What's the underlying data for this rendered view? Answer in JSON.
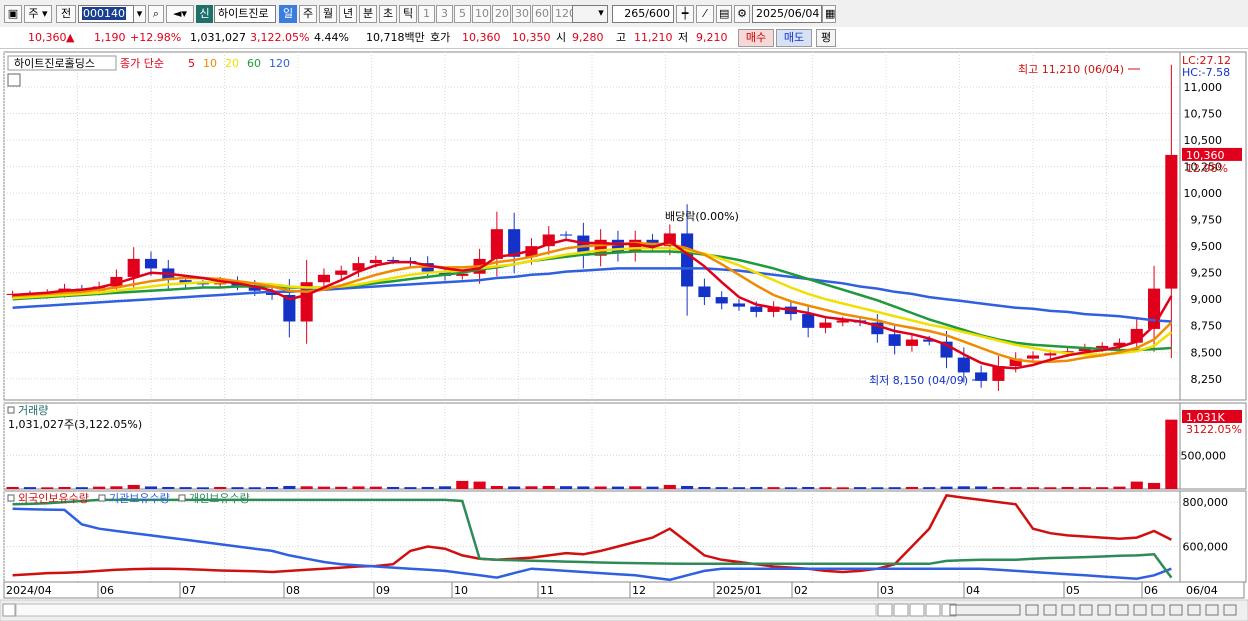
{
  "toolbar": {
    "period_type": "주",
    "prev_label": "전",
    "stock_code": "000140",
    "credit_badge": "신",
    "stock_name": "하이트진로",
    "period_buttons": [
      "일",
      "주",
      "월",
      "년",
      "분",
      "초",
      "틱"
    ],
    "interval_buttons": [
      "1",
      "3",
      "5",
      "10",
      "20",
      "30",
      "60",
      "120"
    ],
    "count_value": "265",
    "count_max": "/600",
    "date": "2025/06/04"
  },
  "quote": {
    "price": "10,360",
    "change_arrow": "▲",
    "change": "1,190",
    "change_pct": "+12.98%",
    "volume": "1,031,027",
    "volume_ratio": "3,122.05%",
    "turnover": "4.44%",
    "amount": "10,718백만",
    "bid_label": "호가",
    "ask_price": "10,360",
    "bid_price": "10,350",
    "open_label": "시",
    "open": "9,280",
    "high_label": "고",
    "high": "11,210",
    "low_label": "저",
    "low": "9,210",
    "buy_label": "매수",
    "sell_label": "매도",
    "eval_label": "평"
  },
  "colors": {
    "up": "#e0001b",
    "down": "#1432c8",
    "ma5": "#e0001b",
    "ma10": "#f08a00",
    "ma20": "#f0e000",
    "ma60": "#1e9a3c",
    "ma120": "#3060e0",
    "foreign": "#d01010",
    "institution": "#3060e0",
    "individual": "#2e8b57"
  },
  "chart_data": [
    {
      "type": "candlestick",
      "title": "하이트진로홀딩스",
      "legend_prefix": "종가 단순",
      "ma_periods": [
        "5",
        "10",
        "20",
        "60",
        "120"
      ],
      "y_ticks": [
        11000,
        10750,
        10500,
        10250,
        10000,
        9750,
        9500,
        9250,
        9000,
        8750,
        8500,
        8250
      ],
      "y_tick_labels": [
        "11,000",
        "10,750",
        "10,500",
        "10,250",
        "10,000",
        "9,750",
        "9,500",
        "9,250",
        "9,000",
        "8,750",
        "8,500",
        "8,250"
      ],
      "ylim": [
        8050,
        11330
      ],
      "lc_label": "LC:27.12",
      "hc_label": "HC:-7.58",
      "last_price_label": "10,360",
      "last_pct_label": "12.98%",
      "high_annotation": "최고 11,210 (06/04)",
      "low_annotation": "최저 8,150 (04/09)",
      "dividend_annotation": "배당락(0.00%)",
      "close": [
        9050,
        9040,
        9060,
        9100,
        9080,
        9120,
        9210,
        9380,
        9290,
        9180,
        9150,
        9140,
        9170,
        9130,
        9080,
        9040,
        8790,
        9160,
        9230,
        9270,
        9340,
        9370,
        9360,
        9340,
        9260,
        9220,
        9240,
        9380,
        9660,
        9400,
        9500,
        9610,
        9600,
        9410,
        9560,
        9440,
        9560,
        9500,
        9620,
        9120,
        9020,
        8960,
        8930,
        8880,
        8930,
        8860,
        8730,
        8780,
        8800,
        8780,
        8670,
        8560,
        8620,
        8600,
        8450,
        8310,
        8230,
        8370,
        8440,
        8470,
        8490,
        8510,
        8540,
        8560,
        8590,
        8720,
        9100,
        10360
      ],
      "ma5": [
        9040,
        9050,
        9060,
        9080,
        9090,
        9110,
        9150,
        9200,
        9250,
        9240,
        9220,
        9200,
        9170,
        9150,
        9120,
        9080,
        9000,
        9040,
        9110,
        9180,
        9260,
        9320,
        9350,
        9350,
        9320,
        9290,
        9270,
        9290,
        9400,
        9420,
        9460,
        9520,
        9560,
        9530,
        9530,
        9520,
        9520,
        9490,
        9540,
        9430,
        9310,
        9160,
        9020,
        8950,
        8920,
        8900,
        8870,
        8830,
        8810,
        8790,
        8750,
        8700,
        8670,
        8630,
        8570,
        8480,
        8400,
        8360,
        8350,
        8380,
        8430,
        8470,
        8500,
        8520,
        8550,
        8600,
        8750,
        9030
      ],
      "ma10": [
        9030,
        9040,
        9050,
        9060,
        9070,
        9090,
        9110,
        9140,
        9170,
        9190,
        9200,
        9200,
        9190,
        9170,
        9150,
        9120,
        9080,
        9070,
        9090,
        9130,
        9180,
        9230,
        9270,
        9300,
        9310,
        9300,
        9300,
        9310,
        9350,
        9370,
        9400,
        9440,
        9480,
        9500,
        9510,
        9520,
        9530,
        9520,
        9520,
        9480,
        9420,
        9330,
        9230,
        9130,
        9040,
        8980,
        8940,
        8900,
        8860,
        8830,
        8800,
        8760,
        8730,
        8700,
        8660,
        8600,
        8540,
        8480,
        8430,
        8410,
        8410,
        8420,
        8450,
        8470,
        8500,
        8540,
        8620,
        8780
      ],
      "ma20": [
        9010,
        9020,
        9030,
        9040,
        9050,
        9060,
        9080,
        9100,
        9120,
        9140,
        9150,
        9160,
        9160,
        9160,
        9150,
        9140,
        9120,
        9110,
        9110,
        9120,
        9140,
        9170,
        9200,
        9230,
        9250,
        9260,
        9270,
        9290,
        9310,
        9330,
        9360,
        9390,
        9420,
        9440,
        9460,
        9470,
        9480,
        9480,
        9480,
        9460,
        9430,
        9380,
        9320,
        9250,
        9180,
        9110,
        9050,
        9000,
        8960,
        8920,
        8880,
        8840,
        8800,
        8760,
        8730,
        8690,
        8650,
        8610,
        8570,
        8540,
        8510,
        8490,
        8480,
        8480,
        8490,
        8510,
        8560,
        8690
      ],
      "ma60": [
        9000,
        9010,
        9020,
        9030,
        9040,
        9050,
        9060,
        9070,
        9080,
        9090,
        9100,
        9110,
        9110,
        9120,
        9120,
        9120,
        9110,
        9110,
        9110,
        9120,
        9130,
        9150,
        9170,
        9190,
        9210,
        9230,
        9250,
        9280,
        9300,
        9330,
        9360,
        9380,
        9400,
        9420,
        9430,
        9440,
        9450,
        9450,
        9450,
        9440,
        9420,
        9400,
        9370,
        9330,
        9290,
        9240,
        9190,
        9140,
        9090,
        9040,
        8990,
        8930,
        8870,
        8810,
        8760,
        8710,
        8660,
        8620,
        8590,
        8570,
        8560,
        8550,
        8540,
        8530,
        8520,
        8520,
        8530,
        8540
      ],
      "ma120": [
        8920,
        8930,
        8940,
        8950,
        8960,
        8970,
        8980,
        8990,
        9000,
        9010,
        9020,
        9030,
        9040,
        9050,
        9060,
        9070,
        9070,
        9080,
        9090,
        9100,
        9110,
        9120,
        9130,
        9140,
        9150,
        9160,
        9170,
        9180,
        9200,
        9210,
        9230,
        9240,
        9260,
        9270,
        9280,
        9290,
        9290,
        9290,
        9290,
        9290,
        9290,
        9280,
        9270,
        9250,
        9230,
        9210,
        9190,
        9170,
        9150,
        9120,
        9100,
        9070,
        9050,
        9020,
        9000,
        8980,
        8960,
        8940,
        8920,
        8910,
        8890,
        8880,
        8860,
        8850,
        8840,
        8820,
        8800,
        8790
      ]
    },
    {
      "type": "bar",
      "title": "거래량",
      "summary": "1,031,027주(3,122.05%)",
      "last_label": "1,031K",
      "last_pct_label": "3122.05%",
      "y_tick_labels": [
        "500,000"
      ],
      "ylim": [
        0,
        1100000
      ],
      "values": [
        30000,
        28000,
        25000,
        30000,
        27000,
        35000,
        40000,
        60000,
        38000,
        30000,
        28000,
        25000,
        30000,
        27000,
        26000,
        30000,
        45000,
        40000,
        35000,
        33000,
        38000,
        35000,
        30000,
        28000,
        30000,
        40000,
        120000,
        110000,
        45000,
        38000,
        40000,
        45000,
        42000,
        38000,
        37000,
        36000,
        40000,
        35000,
        60000,
        45000,
        30000,
        28000,
        27000,
        30000,
        28000,
        26000,
        30000,
        27000,
        25000,
        28000,
        26000,
        27000,
        30000,
        28000,
        35000,
        40000,
        38000,
        30000,
        28000,
        27000,
        26000,
        30000,
        28000,
        27000,
        35000,
        110000,
        90000,
        1031027
      ]
    },
    {
      "type": "line",
      "title": "외국인보유수량",
      "series": [
        {
          "name": "외국인보유수량",
          "values": [
            470000,
            475000,
            480000,
            482000,
            485000,
            490000,
            495000,
            498000,
            500000,
            500000,
            498000,
            495000,
            492000,
            490000,
            488000,
            485000,
            490000,
            495000,
            500000,
            505000,
            510000,
            512000,
            520000,
            580000,
            600000,
            590000,
            560000,
            545000,
            540000,
            545000,
            550000,
            560000,
            570000,
            565000,
            580000,
            600000,
            620000,
            640000,
            680000,
            620000,
            560000,
            540000,
            530000,
            520000,
            510000,
            505000,
            500000,
            490000,
            485000,
            490000,
            500000,
            520000,
            600000,
            680000,
            830000,
            820000,
            810000,
            800000,
            790000,
            680000,
            660000,
            650000,
            645000,
            640000,
            635000,
            640000,
            670000,
            630000
          ]
        },
        {
          "name": "기관보유수량",
          "values": [
            770000,
            768000,
            766000,
            765000,
            700000,
            680000,
            670000,
            660000,
            650000,
            640000,
            630000,
            620000,
            610000,
            600000,
            590000,
            580000,
            560000,
            545000,
            530000,
            520000,
            515000,
            510000,
            505000,
            500000,
            495000,
            490000,
            480000,
            470000,
            460000,
            480000,
            500000,
            495000,
            490000,
            485000,
            480000,
            475000,
            470000,
            460000,
            450000,
            470000,
            490000,
            500000,
            500000,
            500000,
            500000,
            500000,
            500000,
            500000,
            500000,
            500000,
            500000,
            500000,
            500000,
            500000,
            500000,
            500000,
            500000,
            495000,
            490000,
            485000,
            480000,
            475000,
            470000,
            465000,
            460000,
            455000,
            470000,
            500000
          ]
        },
        {
          "name": "개인보유수량",
          "values": [
            790000,
            792000,
            795000,
            800000,
            805000,
            810000,
            810000,
            810000,
            810000,
            810000,
            810000,
            810000,
            810000,
            810000,
            810000,
            810000,
            810000,
            810000,
            810000,
            810000,
            810000,
            810000,
            810000,
            810000,
            810000,
            810000,
            805000,
            545000,
            540000,
            538000,
            536000,
            534000,
            532000,
            530000,
            528000,
            526000,
            525000,
            524000,
            523000,
            522000,
            522000,
            522000,
            522000,
            522000,
            522000,
            522000,
            522000,
            522000,
            522000,
            522000,
            522000,
            522000,
            522000,
            522000,
            535000,
            538000,
            540000,
            540000,
            540000,
            545000,
            548000,
            550000,
            552000,
            555000,
            558000,
            560000,
            565000,
            460000
          ]
        }
      ],
      "y_tick_labels": [
        "800,000",
        "600,000"
      ],
      "ylim": [
        440000,
        850000
      ]
    }
  ],
  "x_axis": {
    "labels": [
      "2024/04",
      "06",
      "07",
      "08",
      "09",
      "10",
      "11",
      "12",
      "2025/01",
      "02",
      "03",
      "04",
      "05",
      "06",
      "06/04"
    ]
  }
}
